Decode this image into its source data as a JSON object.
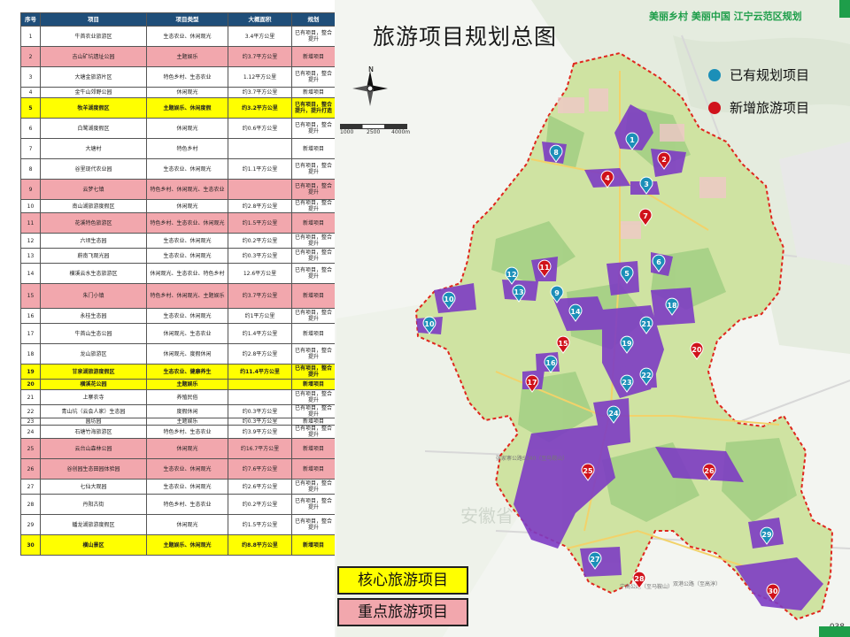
{
  "title": "旅游项目规划总图",
  "slogan": "美丽乡村 美丽中国 江宁云范区规划",
  "page_number": "038",
  "province_label": "安徽省",
  "road_labels": [
    "宁高公路",
    "张家寨公路S340（至马鞍山）",
    "宁高公路（至马鞍山）",
    "双港公路（至高淳）"
  ],
  "north_label": "N",
  "scale_labels": [
    "1000",
    "2500",
    "4000m"
  ],
  "legend": {
    "existing": {
      "label": "已有规划项目",
      "color": "#1b8fb8"
    },
    "new": {
      "label": "新增旅游项目",
      "color": "#d0121b"
    }
  },
  "key_labels": {
    "core": "核心旅游项目",
    "key": "重点旅游项目"
  },
  "colors": {
    "core_bg": "#ffff00",
    "key_bg": "#f2a7ad",
    "project_area": "#7d3cc4",
    "boundary": "#e0261d"
  },
  "table": {
    "headers": [
      "序号",
      "项目",
      "项目类型",
      "大概面积",
      "规划"
    ],
    "rows": [
      {
        "no": "1",
        "name": "牛首农业旅游区",
        "type": "生态农业、休闲观光",
        "area": "3.4平方公里",
        "plan": "已有项目，整合提升",
        "style": ""
      },
      {
        "no": "2",
        "name": "吉山矿坑遗址公园",
        "type": "主题娱乐",
        "area": "约3.7平方公里",
        "plan": "新增项目",
        "style": "key"
      },
      {
        "no": "3",
        "name": "大塘金旅游片区",
        "type": "特色乡村、生态农业",
        "area": "1.12平方公里",
        "plan": "已有项目，整合提升",
        "style": ""
      },
      {
        "no": "4",
        "name": "金牛山郊野公园",
        "type": "休闲观光",
        "area": "约3.7平方公里",
        "plan": "新增项目",
        "style": ""
      },
      {
        "no": "5",
        "name": "牧羊湖度假区",
        "type": "主题娱乐、休闲度假",
        "area": "约3.2平方公里",
        "plan": "已有项目，整合提升，提升打造",
        "style": "core"
      },
      {
        "no": "6",
        "name": "白鹭湖度假区",
        "type": "休闲观光",
        "area": "约0.6平方公里",
        "plan": "已有项目，整合提升",
        "style": ""
      },
      {
        "no": "7",
        "name": "大塘村",
        "type": "特色乡村",
        "area": "",
        "plan": "新增项目",
        "style": ""
      },
      {
        "no": "8",
        "name": "谷里现代农业园",
        "type": "生态农业、休闲观光",
        "area": "约1.1平方公里",
        "plan": "已有项目，整合提升",
        "style": ""
      },
      {
        "no": "9",
        "name": "云梦七镇",
        "type": "特色乡村、休闲观光、生态农业",
        "area": "",
        "plan": "已有项目，整合提升",
        "style": "key"
      },
      {
        "no": "10",
        "name": "南山湖旅游度假区",
        "type": "休闲观光",
        "area": "约2.8平方公里",
        "plan": "已有项目，整合提升",
        "style": ""
      },
      {
        "no": "11",
        "name": "花溪特色旅游区",
        "type": "特色乡村、生态农业、休闲观光",
        "area": "约1.5平方公里",
        "plan": "新增项目",
        "style": "key"
      },
      {
        "no": "12",
        "name": "六顷生态园",
        "type": "生态农业、休闲观光",
        "area": "约0.2平方公里",
        "plan": "已有项目，整合提升",
        "style": ""
      },
      {
        "no": "13",
        "name": "蔚南飞观光园",
        "type": "生态农业、休闲观光",
        "area": "约0.3平方公里",
        "plan": "已有项目，整合提升",
        "style": ""
      },
      {
        "no": "14",
        "name": "横溪云水生态旅游区",
        "type": "休闲观光、生态农业、特色乡村",
        "area": "12.6平方公里",
        "plan": "已有项目，整合提升",
        "style": ""
      },
      {
        "no": "15",
        "name": "朱门小镇",
        "type": "特色乡村、休闲观光、主题娱乐",
        "area": "约3.7平方公里",
        "plan": "新增项目",
        "style": "key"
      },
      {
        "no": "16",
        "name": "永桂生态园",
        "type": "生态农业、休闲观光",
        "area": "约1平方公里",
        "plan": "已有项目，整合提升",
        "style": ""
      },
      {
        "no": "17",
        "name": "牛首山生态公园",
        "type": "休闲观光、生态农业",
        "area": "约1.4平方公里",
        "plan": "新增项目",
        "style": ""
      },
      {
        "no": "18",
        "name": "龙山旅游区",
        "type": "休闲观光、度假休闲",
        "area": "约2.8平方公里",
        "plan": "已有项目，整合提升",
        "style": ""
      },
      {
        "no": "19",
        "name": "甘泉湖旅游度假区",
        "type": "生态农业、健康养生",
        "area": "约11.4平方公里",
        "plan": "已有项目，整合提升",
        "style": "core"
      },
      {
        "no": "20",
        "name": "横溪花公园",
        "type": "主题娱乐",
        "area": "",
        "plan": "新增项目",
        "style": "core"
      },
      {
        "no": "21",
        "name": "上寨农寺",
        "type": "养殖民俗",
        "area": "",
        "plan": "已有项目，整合提升",
        "style": ""
      },
      {
        "no": "22",
        "name": "青山坑（云会人家）生态园",
        "type": "度假休闲",
        "area": "约0.3平方公里",
        "plan": "已有项目，整合提升",
        "style": ""
      },
      {
        "no": "23",
        "name": "圆坊园",
        "type": "主题娱乐",
        "area": "约0.3平方公里",
        "plan": "新增项目",
        "style": ""
      },
      {
        "no": "24",
        "name": "石塘竹海旅游区",
        "type": "特色乡村、生态农业",
        "area": "约3.9平方公里",
        "plan": "已有项目，整合提升",
        "style": ""
      },
      {
        "no": "25",
        "name": "云台山森林公园",
        "type": "休闲观光",
        "area": "约16.7平方公里",
        "plan": "新增项目",
        "style": "key"
      },
      {
        "no": "26",
        "name": "谷创园生态田园体验园",
        "type": "生态农业、休闲观光",
        "area": "约7.6平方公里",
        "plan": "新增项目",
        "style": "key"
      },
      {
        "no": "27",
        "name": "七仙大观园",
        "type": "生态农业、休闲观光",
        "area": "约2.6平方公里",
        "plan": "已有项目，整合提升",
        "style": ""
      },
      {
        "no": "28",
        "name": "丹阳古街",
        "type": "特色乡村、生态农业",
        "area": "约0.2平方公里",
        "plan": "已有项目，整合提升",
        "style": ""
      },
      {
        "no": "29",
        "name": "蟠龙湖旅游度假区",
        "type": "休闲观光",
        "area": "约1.5平方公里",
        "plan": "已有项目，整合提升",
        "style": ""
      },
      {
        "no": "30",
        "name": "横山景区",
        "type": "主题娱乐、休闲观光",
        "area": "约8.8平方公里",
        "plan": "新增项目",
        "style": "core"
      }
    ]
  },
  "markers": [
    {
      "n": "1",
      "kind": "existing"
    },
    {
      "n": "2",
      "kind": "new"
    },
    {
      "n": "3",
      "kind": "existing"
    },
    {
      "n": "4",
      "kind": "new"
    },
    {
      "n": "5",
      "kind": "existing"
    },
    {
      "n": "6",
      "kind": "existing"
    },
    {
      "n": "7",
      "kind": "new"
    },
    {
      "n": "8",
      "kind": "existing"
    },
    {
      "n": "9",
      "kind": "existing"
    },
    {
      "n": "10",
      "kind": "existing"
    },
    {
      "n": "10",
      "kind": "existing"
    },
    {
      "n": "11",
      "kind": "new"
    },
    {
      "n": "12",
      "kind": "existing"
    },
    {
      "n": "13",
      "kind": "existing"
    },
    {
      "n": "14",
      "kind": "existing"
    },
    {
      "n": "15",
      "kind": "new"
    },
    {
      "n": "16",
      "kind": "existing"
    },
    {
      "n": "17",
      "kind": "new"
    },
    {
      "n": "18",
      "kind": "existing"
    },
    {
      "n": "19",
      "kind": "existing"
    },
    {
      "n": "20",
      "kind": "new"
    },
    {
      "n": "21",
      "kind": "existing"
    },
    {
      "n": "22",
      "kind": "existing"
    },
    {
      "n": "23",
      "kind": "existing"
    },
    {
      "n": "24",
      "kind": "existing"
    },
    {
      "n": "25",
      "kind": "new"
    },
    {
      "n": "26",
      "kind": "new"
    },
    {
      "n": "27",
      "kind": "existing"
    },
    {
      "n": "28",
      "kind": "new"
    },
    {
      "n": "29",
      "kind": "existing"
    },
    {
      "n": "30",
      "kind": "new"
    }
  ]
}
